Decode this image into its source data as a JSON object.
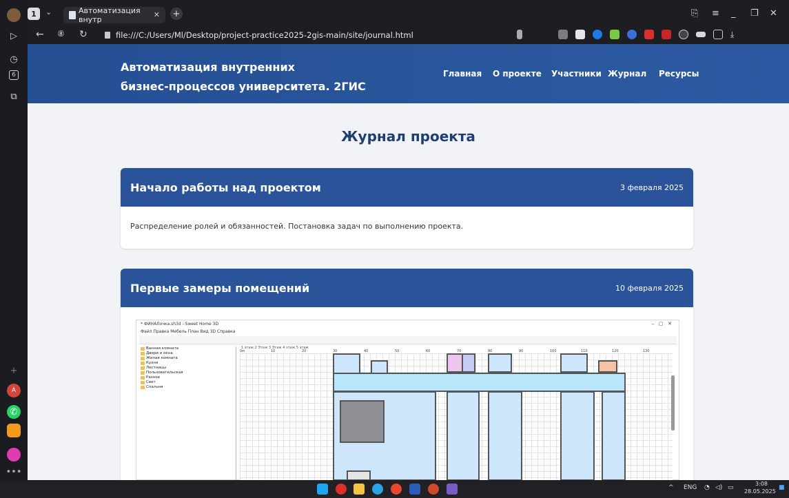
{
  "browser": {
    "workspace_number": "1",
    "tab_title": "Автоматизация внутр",
    "url": "file:///C:/Users/Ml/Desktop/project-practice2025-2gis-main/site/journal.html"
  },
  "site": {
    "brand_line1": "Автоматизация внутренних",
    "brand_line2": "бизнес-процессов университета. 2ГИС",
    "nav": [
      "Главная",
      "О проекте",
      "Участники",
      "Журнал",
      "Ресурсы"
    ],
    "page_title": "Журнал проекта",
    "entries": [
      {
        "title": "Начало работы над проектом",
        "date": "3 февраля 2025",
        "text": "Распределение ролей и обязанностей. Постановка задач по выполнению проекта."
      },
      {
        "title": "Первые замеры помещений",
        "date": "10 февраля 2025",
        "text": ""
      }
    ]
  },
  "screenshot": {
    "window_title": "* ФИНАЛочка.sh3d - Sweet Home 3D",
    "menu": "Файл  Правка  Мебель  План  Вид 3D  Справка",
    "tabs": "1 этаж  2 Этаж  3 Этаж  4 этаж  5 этаж",
    "tree": [
      "Ванная комната",
      "Двери и окна",
      "Жилая комната",
      "Кухня",
      "Лестницы",
      "Пользовательская",
      "Разное",
      "Свет",
      "Спальня"
    ],
    "ruler": [
      "0м",
      "10",
      "20",
      "30",
      "40",
      "50",
      "60",
      "70",
      "80",
      "90",
      "100",
      "110",
      "120",
      "130"
    ]
  },
  "taskbar": {
    "lang": "ENG",
    "time": "3:08",
    "date": "28.05.2025"
  }
}
